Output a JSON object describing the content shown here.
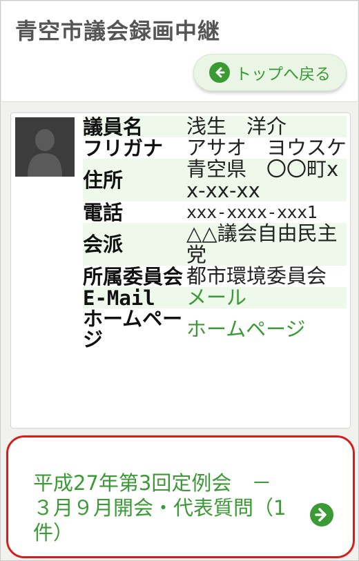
{
  "app": {
    "title": "青空市議会録画中継"
  },
  "nav": {
    "back_label": "トップへ戻る"
  },
  "profile": {
    "rows": [
      {
        "label": "議員名",
        "value": "浅生　洋介"
      },
      {
        "label": "フリガナ",
        "value": "アサオ　ヨウスケ"
      },
      {
        "label": "住所",
        "value": "青空県　〇〇町xx-xx-xx"
      },
      {
        "label": "電話",
        "value": "xxx-xxxx-xxx1"
      },
      {
        "label": "会派",
        "value": "△△議会自由民主党"
      },
      {
        "label": "所属委員会",
        "value": "都市環境委員会"
      },
      {
        "label": "E-Mail",
        "value": "メール"
      },
      {
        "label": "ホームページ",
        "value": "ホームページ"
      }
    ]
  },
  "meetings": [
    {
      "title": "平成27年第3回定例会　－　３月９月開会・代表質問（1件）"
    }
  ],
  "colors": {
    "accent_green": "#3a9a34",
    "highlight_red": "#d61d1d",
    "row_shade": "#eef8eb"
  },
  "icons": {
    "back": "arrow-left-circle-icon",
    "avatar": "person-silhouette-icon",
    "meeting": "arrow-right-circle-icon"
  }
}
